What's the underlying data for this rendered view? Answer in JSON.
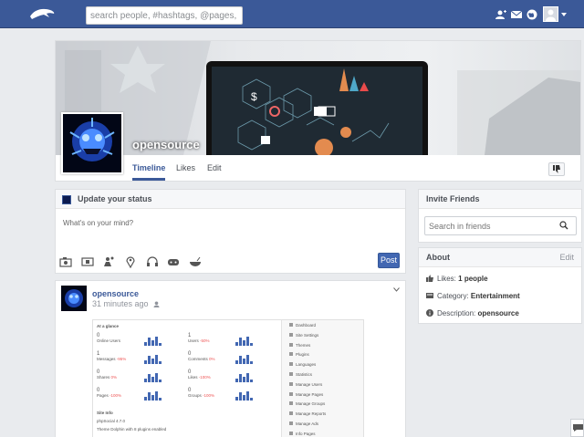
{
  "header": {
    "search_placeholder": "search people, #hashtags, @pages, !groups",
    "icons": [
      "dolphin-logo-icon",
      "friends-icon",
      "mail-icon",
      "globe-icon",
      "user-avatar",
      "caret-down-icon"
    ],
    "brand_color": "#3b5998"
  },
  "profile": {
    "name": "opensource",
    "tabs": [
      "Timeline",
      "Likes",
      "Edit"
    ],
    "active_tab": "Timeline"
  },
  "status_box": {
    "title": "Update your status",
    "placeholder": "What's on your mind?",
    "post_label": "Post",
    "tools": [
      "camera-icon",
      "film-icon",
      "location-people-icon",
      "map-pin-icon",
      "headphones-icon",
      "gamepad-icon",
      "food-bowl-icon"
    ]
  },
  "post": {
    "author": "opensource",
    "time": "31 minutes ago",
    "screenshot": {
      "section_title": "At a glance",
      "stats": [
        {
          "value": "0",
          "label": "Online Users",
          "delta": ""
        },
        {
          "value": "1",
          "label": "Users",
          "delta": "-50%"
        },
        {
          "value": "1",
          "label": "Messages",
          "delta": "-95%"
        },
        {
          "value": "0",
          "label": "Comments",
          "delta": "0%"
        },
        {
          "value": "0",
          "label": "Shares",
          "delta": "0%"
        },
        {
          "value": "0",
          "label": "Likes",
          "delta": "-100%"
        },
        {
          "value": "0",
          "label": "Pages",
          "delta": "-100%"
        },
        {
          "value": "0",
          "label": "Groups",
          "delta": "-100%"
        }
      ],
      "site_info_title": "Site Info",
      "site_info_version": "phpSocial 4.7.0",
      "site_info_theme": "Theme Dolphin with 8 plugins enabled",
      "menu": [
        "Dashboard",
        "Site Settings",
        "Themes",
        "Plugins",
        "Languages",
        "Statistics",
        "Manage Users",
        "Manage Pages",
        "Manage Groups",
        "Manage Reports",
        "Manage Ads",
        "Info Pages"
      ]
    }
  },
  "invite": {
    "title": "Invite Friends",
    "placeholder": "Search in friends"
  },
  "about": {
    "title": "About",
    "edit_label": "Edit",
    "likes_label": "Likes:",
    "likes_value": "1 people",
    "category_label": "Category:",
    "category_value": "Entertainment",
    "description_label": "Description:",
    "description_value": "opensource"
  }
}
